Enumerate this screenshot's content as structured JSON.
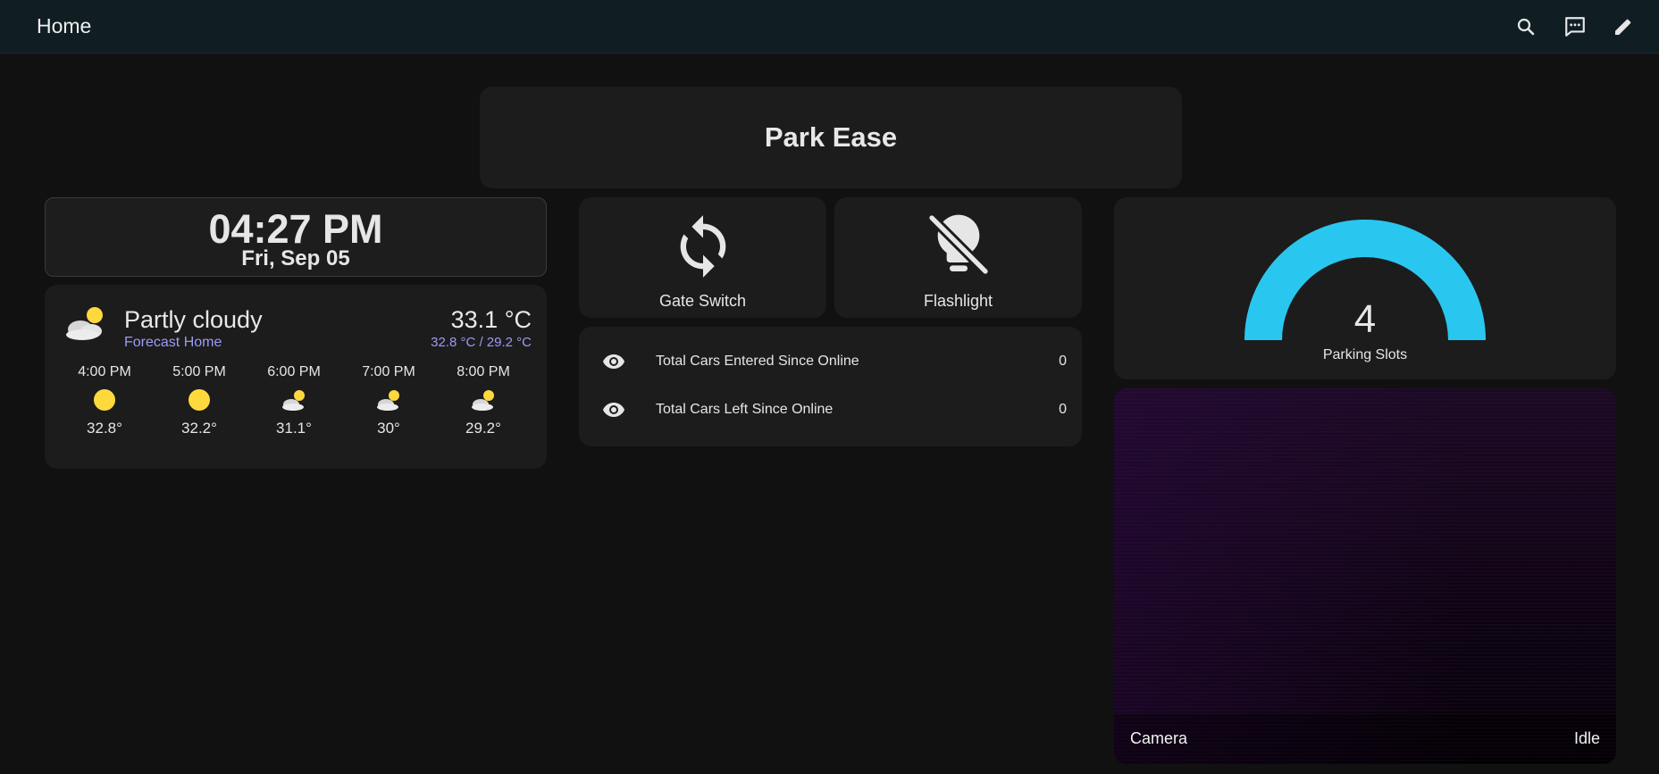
{
  "topbar": {
    "title": "Home",
    "icons": [
      "search-icon",
      "assist-chat-icon",
      "edit-pencil-icon"
    ]
  },
  "header": {
    "title": "Park Ease"
  },
  "clock": {
    "time": "04:27 PM",
    "date": "Fri, Sep 05"
  },
  "weather": {
    "condition": "Partly cloudy",
    "forecast_name": "Forecast Home",
    "temperature": "33.1 °C",
    "high_low": "32.8 °C / 29.2 °C",
    "icon": "partly-cloudy-icon",
    "forecast": [
      {
        "time": "4:00 PM",
        "temp": "32.8°",
        "icon": "sunny-icon"
      },
      {
        "time": "5:00 PM",
        "temp": "32.2°",
        "icon": "sunny-icon"
      },
      {
        "time": "6:00 PM",
        "temp": "31.1°",
        "icon": "partly-cloudy-icon"
      },
      {
        "time": "7:00 PM",
        "temp": "30°",
        "icon": "partly-cloudy-icon"
      },
      {
        "time": "8:00 PM",
        "temp": "29.2°",
        "icon": "partly-cloudy-icon"
      }
    ]
  },
  "buttons": {
    "gate": {
      "label": "Gate Switch",
      "icon": "sync-icon"
    },
    "flashlight": {
      "label": "Flashlight",
      "icon": "lightbulb-off-icon"
    }
  },
  "entities": [
    {
      "name": "Total Cars Entered Since Online",
      "value": "0",
      "icon": "eye-icon"
    },
    {
      "name": "Total Cars Left Since Online",
      "value": "0",
      "icon": "eye-icon"
    }
  ],
  "gauge": {
    "value": "4",
    "name": "Parking Slots",
    "fill_fraction": 1.0,
    "color": "#29c7ef"
  },
  "camera": {
    "name": "Camera",
    "state": "Idle"
  },
  "colors": {
    "background": "#111111",
    "card": "#1c1c1d",
    "topbar": "#101e24",
    "accent_secondary": "#9a9cf2",
    "sun": "#fdd93d"
  }
}
